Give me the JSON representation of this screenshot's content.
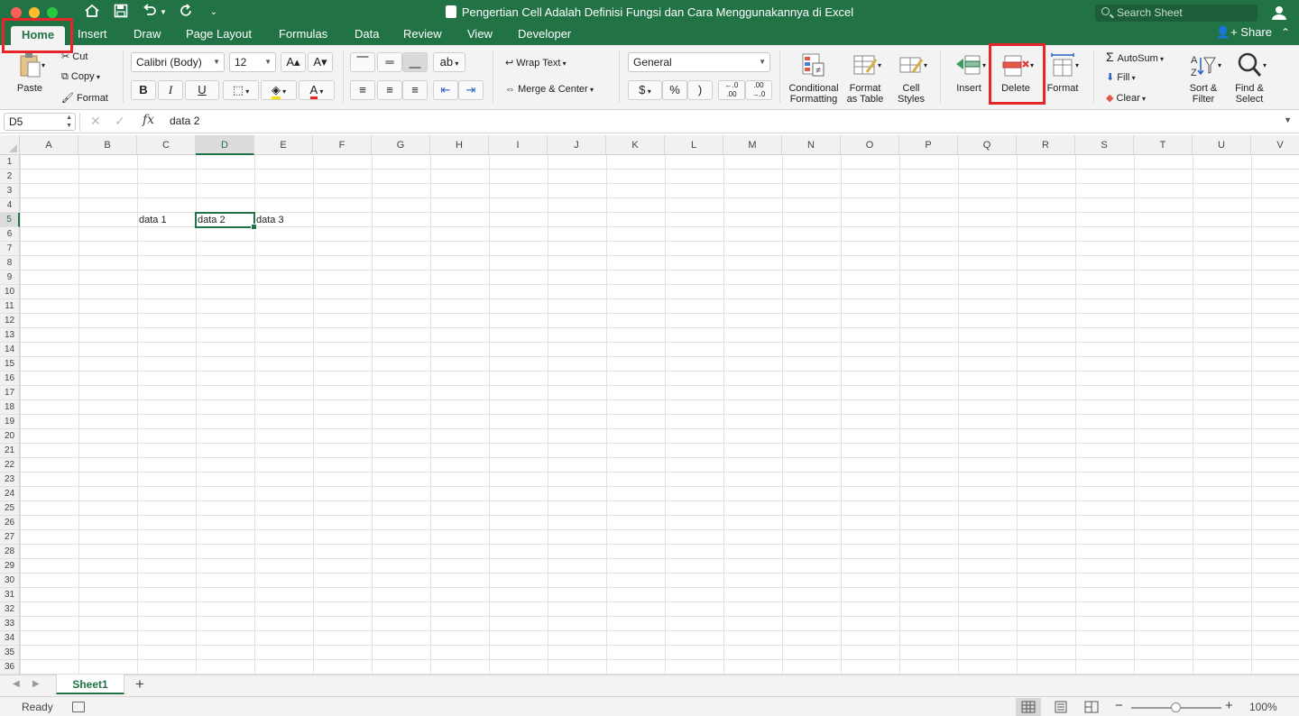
{
  "window": {
    "title": "Pengertian Cell Adalah Definisi Fungsi dan Cara Menggunakannya di Excel",
    "search_placeholder": "Search Sheet"
  },
  "tabs": [
    "Home",
    "Insert",
    "Draw",
    "Page Layout",
    "Formulas",
    "Data",
    "Review",
    "View",
    "Developer"
  ],
  "share_label": "Share",
  "ribbon": {
    "paste": "Paste",
    "cut": "Cut",
    "copy": "Copy",
    "format_painter": "Format",
    "font_name": "Calibri (Body)",
    "font_size": "12",
    "bold": "B",
    "italic": "I",
    "underline": "U",
    "wrap_text": "Wrap Text",
    "merge_center": "Merge & Center",
    "number_format": "General",
    "currency": "$",
    "percent": "%",
    "comma": ")",
    "conditional_1": "Conditional",
    "conditional_2": "Formatting",
    "format_table_1": "Format",
    "format_table_2": "as Table",
    "cell_styles_1": "Cell",
    "cell_styles_2": "Styles",
    "insert": "Insert",
    "delete": "Delete",
    "format": "Format",
    "autosum": "AutoSum",
    "fill": "Fill",
    "clear": "Clear",
    "sort_1": "Sort &",
    "sort_2": "Filter",
    "find_1": "Find &",
    "find_2": "Select"
  },
  "formula_bar": {
    "name_box": "D5",
    "content": "data 2"
  },
  "grid": {
    "columns": [
      "A",
      "B",
      "C",
      "D",
      "E",
      "F",
      "G",
      "H",
      "I",
      "J",
      "K",
      "L",
      "M",
      "N",
      "O",
      "P",
      "Q",
      "R",
      "S",
      "T",
      "U",
      "V"
    ],
    "rows": [
      "1",
      "2",
      "3",
      "4",
      "5",
      "6",
      "7",
      "8",
      "9",
      "10",
      "11",
      "12",
      "13",
      "14",
      "15",
      "16",
      "17",
      "18",
      "19",
      "20",
      "21",
      "22",
      "23",
      "24",
      "25",
      "26",
      "27",
      "28",
      "29",
      "30",
      "31",
      "32",
      "33",
      "34",
      "35",
      "36"
    ],
    "active_column": "D",
    "active_row": "5",
    "cells": [
      {
        "ref": "C5",
        "value": "data 1"
      },
      {
        "ref": "D5",
        "value": "data 2"
      },
      {
        "ref": "E5",
        "value": "data 3"
      }
    ]
  },
  "sheets": [
    "Sheet1"
  ],
  "status": {
    "ready": "Ready",
    "zoom": "100%",
    "zoom_fraction": 0.5
  },
  "colors": {
    "excel_green": "#217346",
    "highlight_red": "#e8262a"
  }
}
